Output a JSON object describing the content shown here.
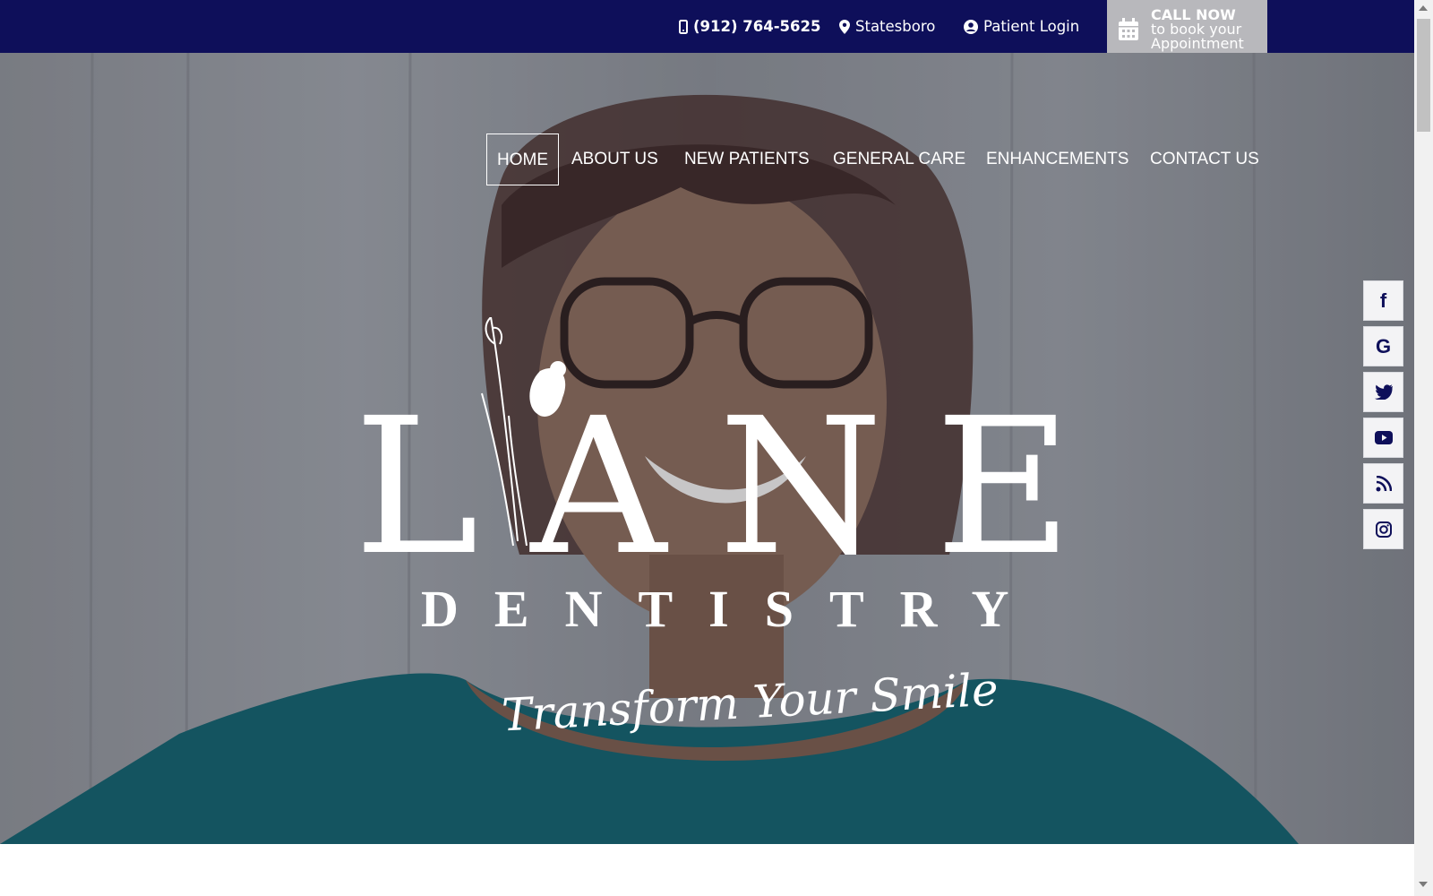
{
  "topbar": {
    "phone": "(912) 764-5625",
    "location": "Statesboro",
    "login": "Patient Login",
    "cta_bold": "CALL NOW",
    "cta_line2": "to book your",
    "cta_line3": "Appointment"
  },
  "nav": {
    "items": [
      "HOME",
      "ABOUT US",
      "NEW PATIENTS",
      "GENERAL CARE",
      "ENHANCEMENTS",
      "CONTACT US"
    ],
    "active": "HOME"
  },
  "hero": {
    "logo_main": "LANE",
    "logo_sub": "DENTISTRY",
    "tagline": "Transform Your Smile"
  },
  "social": [
    "facebook",
    "google",
    "twitter",
    "youtube",
    "rss",
    "instagram"
  ],
  "colors": {
    "brand_navy": "#0e0f5a",
    "cta_gray": "#b8b8bc",
    "hero_teal": "#0f5f6b"
  }
}
